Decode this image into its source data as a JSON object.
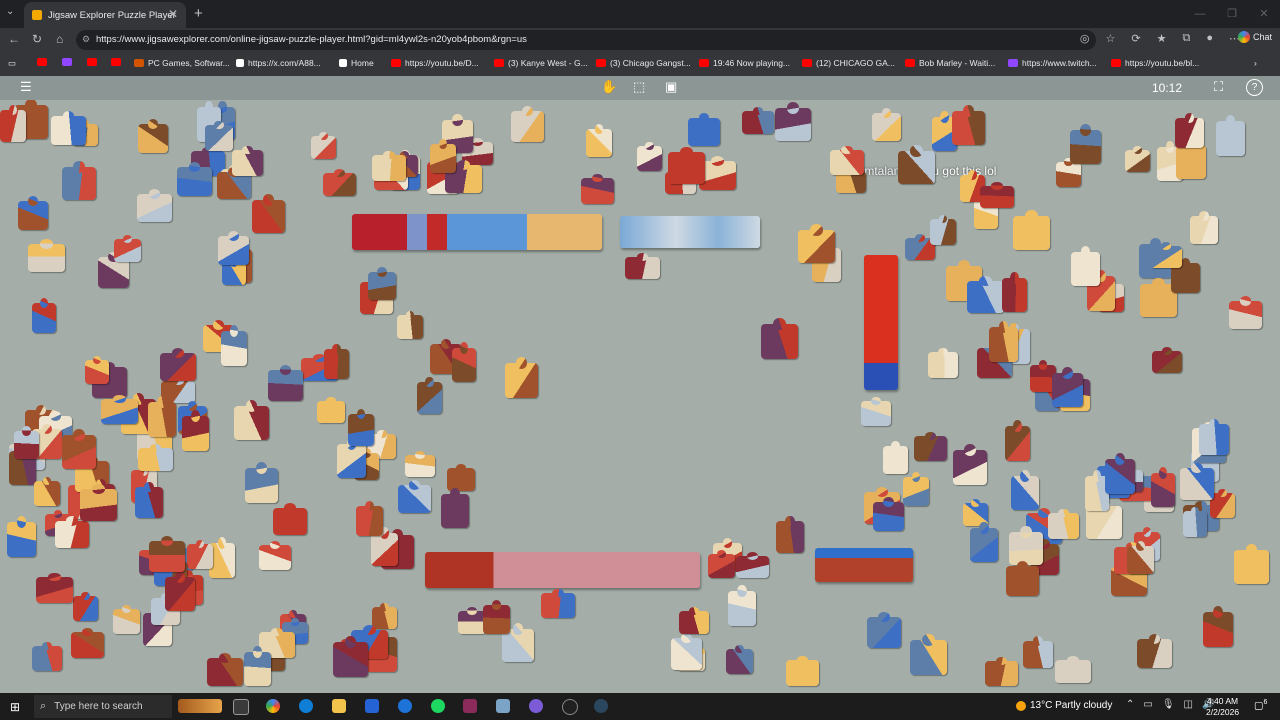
{
  "browser": {
    "tab_title": "Jigsaw Explorer Puzzle Player",
    "tab_close": "✕",
    "new_tab": "+",
    "tab_menu": "⌄",
    "window_controls": [
      "—",
      "❐",
      "✕"
    ],
    "url": "https://www.jigsawexplorer.com/online-jigsaw-puzzle-player.html?gid=ml4ywl2s-n20yob4pbom&rgn=us",
    "chat_label": "Chat",
    "bookmarks": [
      {
        "label": "",
        "color": "#ff0000"
      },
      {
        "label": "",
        "color": "#9146ff"
      },
      {
        "label": "",
        "color": "#ff0000"
      },
      {
        "label": "",
        "color": "#ff0000"
      },
      {
        "label": "PC Games, Softwar...",
        "color": "#d35400"
      },
      {
        "label": "https://x.com/A88...",
        "color": "#ffffff"
      },
      {
        "label": "Home",
        "color": "#ffffff"
      },
      {
        "label": "https://youtu.be/D...",
        "color": "#ff0000"
      },
      {
        "label": "(3) Kanye West - G...",
        "color": "#ff0000"
      },
      {
        "label": "(3) Chicago Gangst...",
        "color": "#ff0000"
      },
      {
        "label": "19:46 Now playing...",
        "color": "#ff0000"
      },
      {
        "label": "(12) CHICAGO GA...",
        "color": "#ff0000"
      },
      {
        "label": "Bob Marley - Waiti...",
        "color": "#ff0000"
      },
      {
        "label": "https://www.twitch...",
        "color": "#9146ff"
      },
      {
        "label": "https://youtu.be/bl...",
        "color": "#ff0000"
      }
    ]
  },
  "puzzle": {
    "menu_icon": "☰",
    "timer": "10:12",
    "help_icon": "?",
    "chat_overlay": {
      "user": "iamtalanya:",
      "message": "you got this lol"
    }
  },
  "taskbar": {
    "search_placeholder": "Type here to search",
    "weather": "13°C  Partly cloudy",
    "time": "4:40 AM",
    "date": "2/2/2026",
    "notification_count": "6"
  }
}
